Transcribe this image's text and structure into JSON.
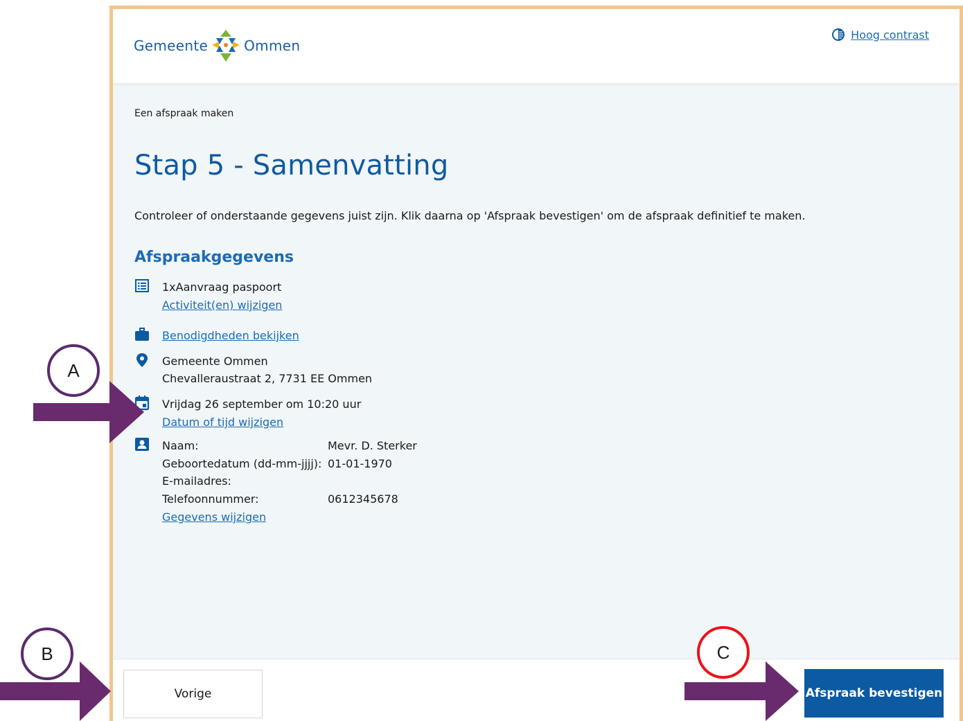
{
  "header": {
    "logo_left": "Gemeente",
    "logo_right": "Ommen",
    "high_contrast_label": "Hoog contrast"
  },
  "main": {
    "breadcrumb": "Een afspraak maken",
    "title": "Stap 5 - Samenvatting",
    "intro": "Controleer of onderstaande gegevens juist zijn. Klik daarna op 'Afspraak bevestigen' om de afspraak definitief te maken.",
    "section_title": "Afspraakgegevens",
    "activity": {
      "text": "1xAanvraag paspoort",
      "link": "Activiteit(en) wijzigen"
    },
    "requirements_link": "Benodigdheden bekijken",
    "location": {
      "name": "Gemeente Ommen",
      "address": "Chevalleraustraat 2, 7731 EE Ommen"
    },
    "datetime": {
      "text": "Vrijdag 26 september om 10:20 uur",
      "link": "Datum of tijd wijzigen"
    },
    "person": {
      "rows": [
        {
          "label": "Naam:",
          "value": "Mevr. D. Sterker"
        },
        {
          "label": "Geboortedatum (dd-mm-jjjj):",
          "value": "01-01-1970"
        },
        {
          "label": "E-mailadres:",
          "value": ""
        },
        {
          "label": "Telefoonnummer:",
          "value": "0612345678"
        }
      ],
      "link": "Gegevens wijzigen"
    }
  },
  "footer": {
    "prev_label": "Vorige",
    "confirm_label": "Afspraak bevestigen"
  },
  "annotations": {
    "a": "A",
    "b": "B",
    "c": "C"
  },
  "colors": {
    "frame": "#f1c58e",
    "primary": "#0c5aa2",
    "link": "#1b6bb7",
    "arrow": "#6a2a6e",
    "circle_c": "#e8141b"
  }
}
